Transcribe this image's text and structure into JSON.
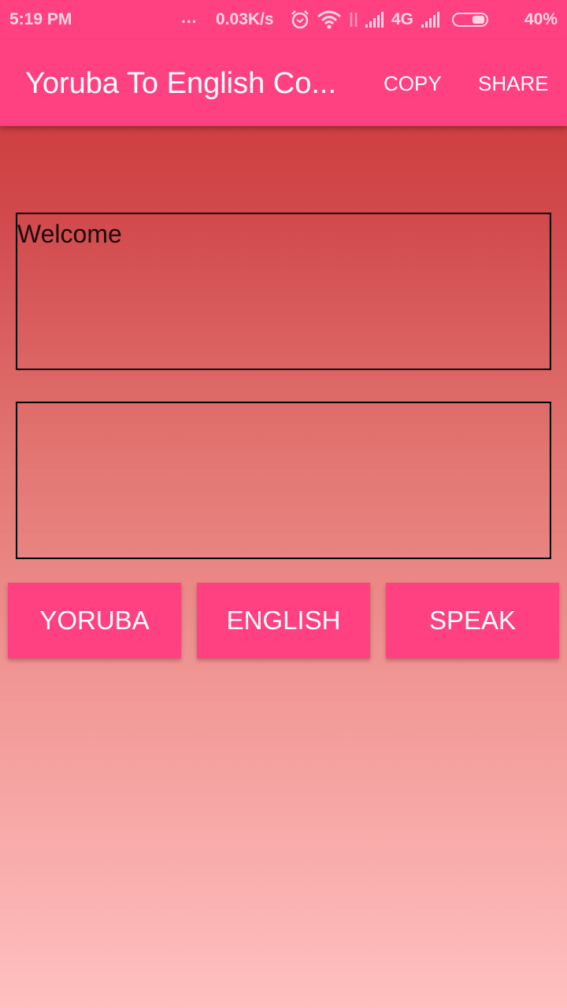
{
  "status_bar": {
    "time": "5:19 PM",
    "overflow": "...",
    "network_speed": "0.03K/s",
    "network_type": "4G",
    "battery_percent": "40%",
    "battery_level": 0.4,
    "icons": [
      "alarm-icon",
      "wifi-icon",
      "data-transfer-icon",
      "signal-icon",
      "signal-icon",
      "battery-icon"
    ]
  },
  "app_bar": {
    "title": "Yoruba To English Co...",
    "actions": [
      {
        "label": "COPY"
      },
      {
        "label": "SHARE"
      }
    ],
    "color": "#ff4081"
  },
  "main": {
    "input_text": "Welcome",
    "output_text": "",
    "buttons": [
      {
        "label": "YORUBA"
      },
      {
        "label": "ENGLISH"
      },
      {
        "label": "SPEAK"
      }
    ]
  }
}
